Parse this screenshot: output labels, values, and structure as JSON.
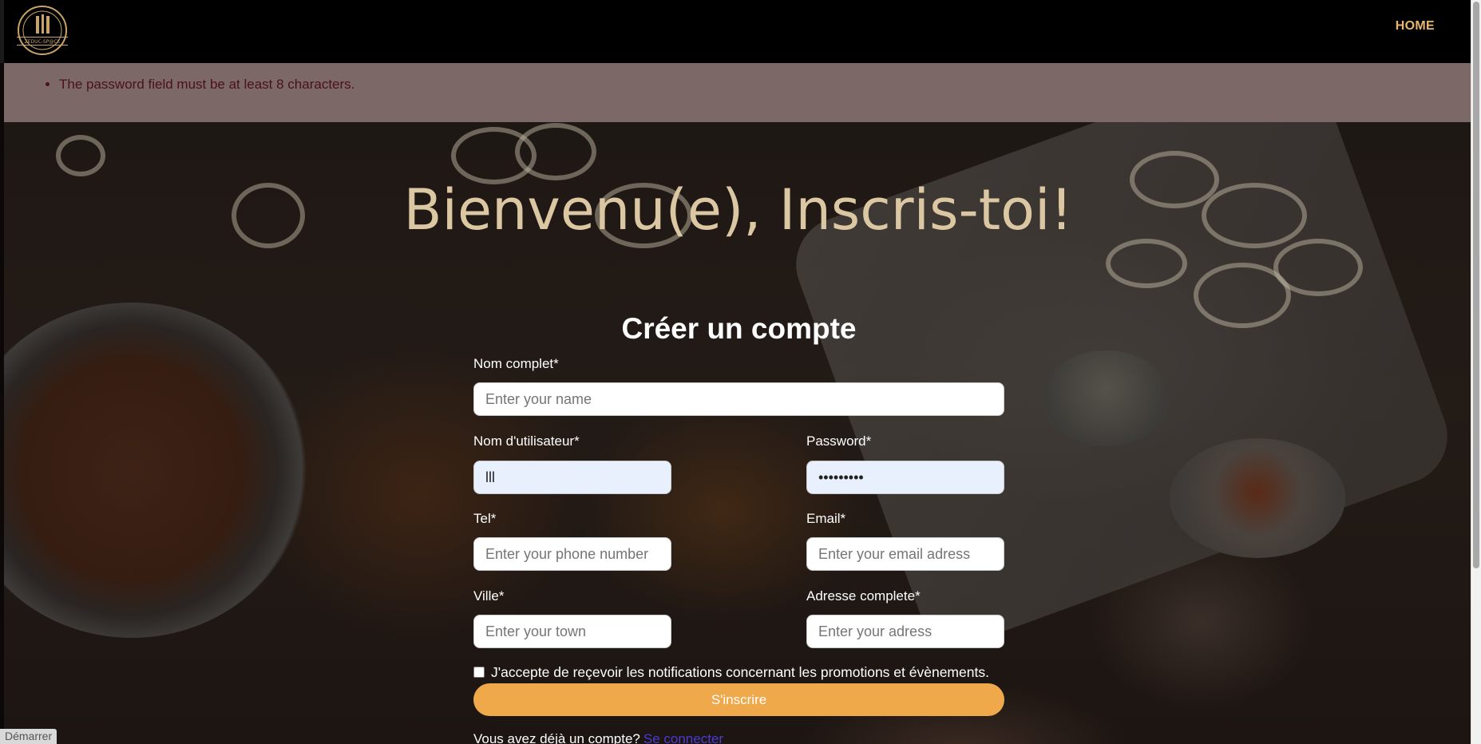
{
  "nav": {
    "logo_text": "ZEDUC-SP@CE",
    "home_label": "HOME"
  },
  "alert": {
    "messages": [
      "The password field must be at least 8 characters."
    ]
  },
  "hero": {
    "title": "Bienvenu(e), Inscris-toi!"
  },
  "form": {
    "title": "Créer un compte",
    "fullname": {
      "label": "Nom complet*",
      "placeholder": "Enter your name",
      "value": ""
    },
    "username": {
      "label": "Nom d'utilisateur*",
      "placeholder": "",
      "value": "lll"
    },
    "password": {
      "label": "Password*",
      "placeholder": "",
      "value": "•••••••••"
    },
    "tel": {
      "label": "Tel*",
      "placeholder": "Enter your phone number",
      "value": ""
    },
    "email": {
      "label": "Email*",
      "placeholder": "Enter your email adress",
      "value": ""
    },
    "city": {
      "label": "Ville*",
      "placeholder": "Enter your town",
      "value": ""
    },
    "address": {
      "label": "Adresse complete*",
      "placeholder": "Enter your adress",
      "value": ""
    },
    "consent_label": "J'accepte de reçevoir les notifications concernant les promotions et évènements.",
    "submit_label": "S'inscrire",
    "login_prompt": "Vous avez déjà un compte?",
    "login_link": "Se connecter"
  },
  "taskbar": {
    "start_label": "Démarrer"
  },
  "colors": {
    "navbar": "#000000",
    "accent": "#efa94a",
    "nav_link": "#e8b86d",
    "hero_title": "#dcc7a3",
    "alert_bg": "#7b6867",
    "alert_text": "#4a1216",
    "autofill_bg": "#e8f0fe"
  }
}
